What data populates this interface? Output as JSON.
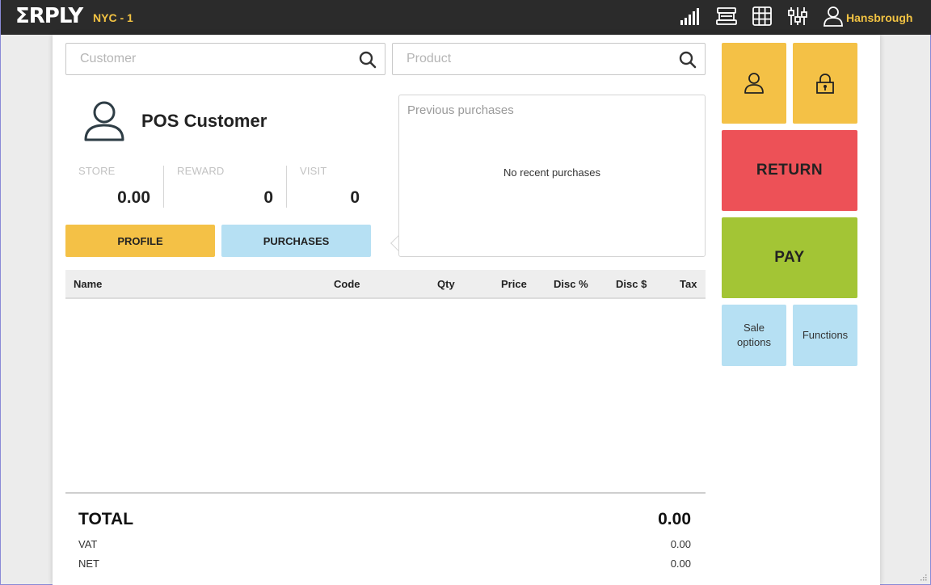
{
  "header": {
    "logo": "ΣRPLY",
    "store": "NYC - 1",
    "user": "Hansbrough",
    "icons": [
      "signal-bars-icon",
      "cash-register-icon",
      "grid-icon",
      "sliders-icon",
      "user-icon"
    ]
  },
  "search": {
    "customer_placeholder": "Customer",
    "product_placeholder": "Product"
  },
  "customer": {
    "name": "POS Customer",
    "stats": [
      {
        "label": "STORE",
        "value": "0.00"
      },
      {
        "label": "REWARD",
        "value": "0"
      },
      {
        "label": "VISIT",
        "value": "0"
      }
    ],
    "profile_button": "PROFILE",
    "purchases_button": "PURCHASES"
  },
  "previous_purchases": {
    "title": "Previous purchases",
    "empty_text": "No recent purchases"
  },
  "table": {
    "columns": [
      "Name",
      "Code",
      "Qty",
      "Price",
      "Disc %",
      "Disc $",
      "Tax"
    ],
    "rows": []
  },
  "totals": {
    "total_label": "TOTAL",
    "total_value": "0.00",
    "vat_label": "VAT",
    "vat_value": "0.00",
    "net_label": "NET",
    "net_value": "0.00"
  },
  "actions": {
    "return_label": "RETURN",
    "pay_label": "PAY",
    "sale_options_label": "Sale options",
    "functions_label": "Functions"
  },
  "colors": {
    "topbar": "#2b2b2b",
    "accent_yellow": "#f4c146",
    "return_red": "#ed5157",
    "pay_green": "#a3c535",
    "light_blue": "#b6e0f3"
  }
}
